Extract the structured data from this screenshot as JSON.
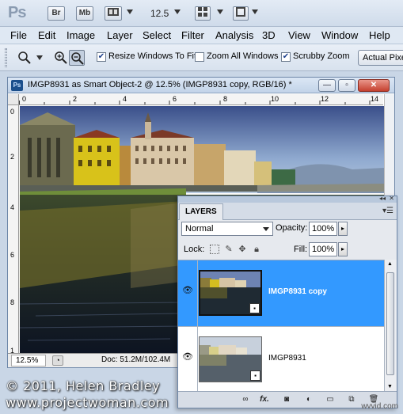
{
  "app": {
    "logo": "Ps",
    "buttons": [
      "Br",
      "Mb"
    ],
    "zoom": "12.5"
  },
  "menu": [
    "File",
    "Edit",
    "Image",
    "Layer",
    "Select",
    "Filter",
    "Analysis",
    "3D",
    "View",
    "Window",
    "Help"
  ],
  "options": {
    "resize_windows": {
      "label": "Resize Windows To Fit",
      "checked": true
    },
    "zoom_all": {
      "label": "Zoom All Windows",
      "checked": false
    },
    "scrubby": {
      "label": "Scrubby Zoom",
      "checked": true
    },
    "actual_pixels": "Actual Pixels"
  },
  "document": {
    "badge": "Ps",
    "title": "IMGP8931 as Smart Object-2 @ 12.5% (IMGP8931 copy, RGB/16) *",
    "ruler_top": [
      "0",
      "2",
      "4",
      "6",
      "8",
      "10",
      "12",
      "14"
    ],
    "ruler_left": [
      "0",
      "2",
      "4",
      "6",
      "8",
      "1"
    ],
    "status_zoom": "12.5%",
    "status_doc": "Doc: 51.2M/102.4M"
  },
  "layers_panel": {
    "tab": "LAYERS",
    "blend_mode": "Normal",
    "opacity_label": "Opacity:",
    "opacity": "100%",
    "lock_label": "Lock:",
    "fill_label": "Fill:",
    "fill": "100%",
    "layers": [
      {
        "name": "IMGP8931 copy",
        "selected": true
      },
      {
        "name": "IMGP8931",
        "selected": false
      }
    ],
    "footer_icons": [
      "link-icon",
      "fx-icon",
      "mask-icon",
      "adjustment-icon",
      "folder-icon",
      "new-layer-icon",
      "trash-icon"
    ],
    "fx": "fx."
  },
  "credit": {
    "line1": "© 2011, Helen Bradley",
    "line2": "www.projectwoman.com"
  },
  "watermark": "wvvid.com",
  "colors": {
    "selection": "#3399ff",
    "window_frame": "#6e87a8"
  }
}
